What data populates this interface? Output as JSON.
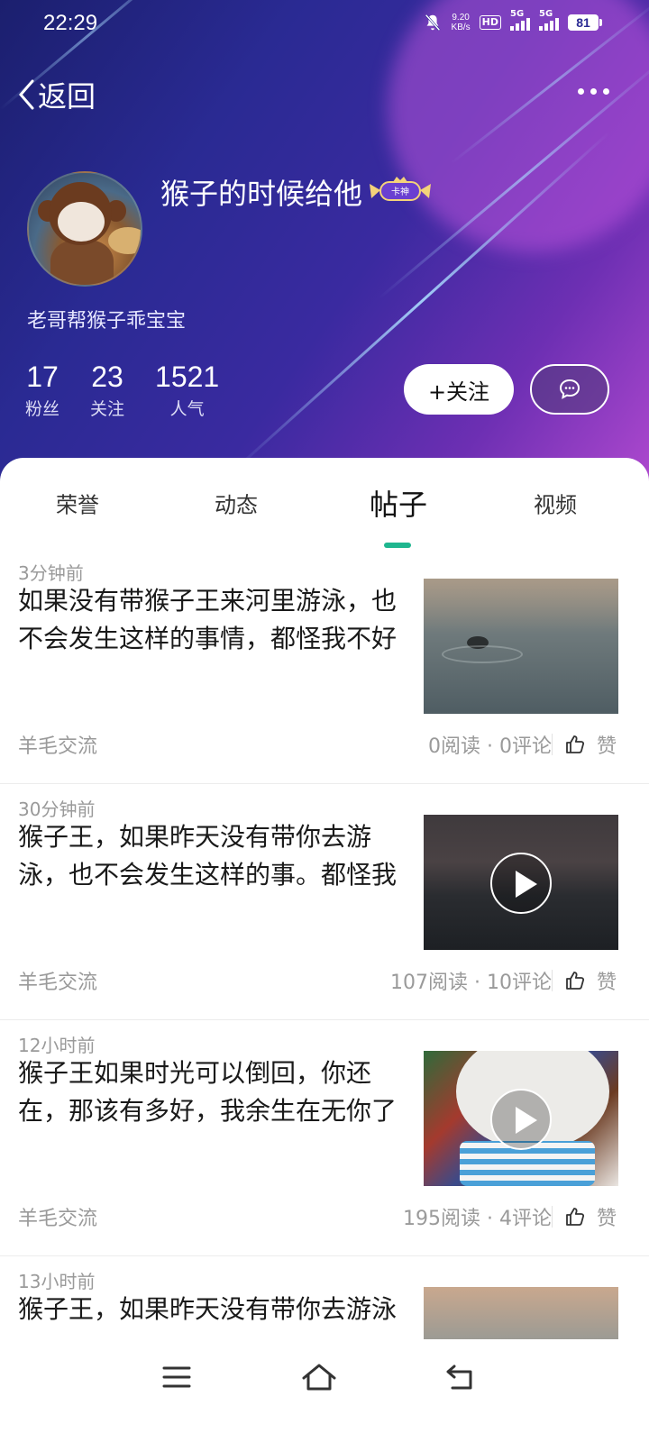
{
  "status_bar": {
    "time": "22:29",
    "net_speed_value": "9.20",
    "net_speed_unit": "KB/s",
    "hd": "HD",
    "signal1": "5G",
    "signal2": "5G",
    "battery": "81"
  },
  "top_bar": {
    "back_label": "返回"
  },
  "profile": {
    "name": "猴子的时候给他",
    "badge_text": "卡神",
    "bio": "老哥帮猴子乖宝宝",
    "stats": [
      {
        "value": "17",
        "label": "粉丝"
      },
      {
        "value": "23",
        "label": "关注"
      },
      {
        "value": "1521",
        "label": "人气"
      }
    ],
    "follow_label": "+关注"
  },
  "tabs": [
    {
      "label": "荣誉"
    },
    {
      "label": "动态"
    },
    {
      "label": "帖子",
      "active": true
    },
    {
      "label": "视频"
    }
  ],
  "posts": [
    {
      "time": "3分钟前",
      "text": "如果没有带猴子王来河里游泳，也不会发生这样的事情，都怪我不好",
      "category": "羊毛交流",
      "reads": "0阅读",
      "comments": "0评论",
      "like_label": "赞",
      "thumb": "water",
      "video": false
    },
    {
      "time": "30分钟前",
      "text": "猴子王，如果昨天没有带你去游泳，也不会发生这样的事。都怪我",
      "category": "羊毛交流",
      "reads": "107阅读",
      "comments": "10评论",
      "like_label": "赞",
      "thumb": "dusk",
      "video": true
    },
    {
      "time": "12小时前",
      "text": "猴子王如果时光可以倒回，你还在，那该有多好，我余生在无你了",
      "category": "羊毛交流",
      "reads": "195阅读",
      "comments": "4评论",
      "like_label": "赞",
      "thumb": "plush",
      "video": true
    },
    {
      "time": "13小时前",
      "text": "猴子王，如果昨天没有带你去游泳",
      "thumb": "water",
      "video": false
    }
  ],
  "meta_separator": " · ",
  "colors": {
    "accent": "#1fb68f",
    "hero_start": "#1b1f6e",
    "hero_end": "#b24ad0"
  }
}
